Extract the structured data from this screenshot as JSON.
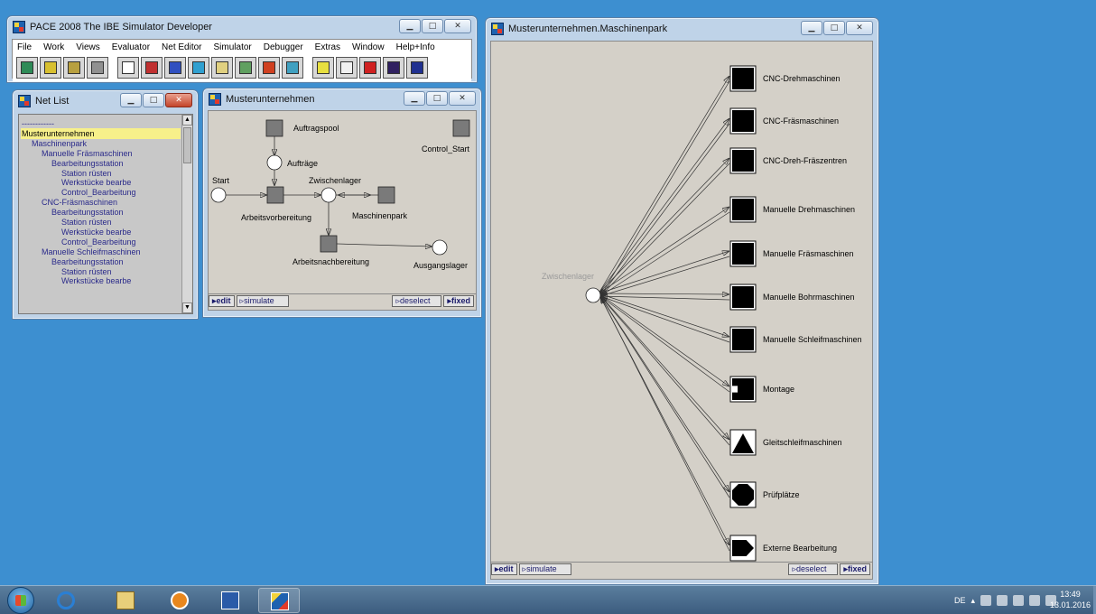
{
  "main_window": {
    "title": "PACE 2008   The IBE Simulator Developer",
    "menu": [
      "File",
      "Work",
      "Views",
      "Evaluator",
      "Net Editor",
      "Simulator",
      "Debugger",
      "Extras",
      "Window",
      "Help+Info"
    ],
    "toolbar_icons": [
      "palette-icon",
      "open-icon",
      "save-icon",
      "copy-icon",
      "grid-icon",
      "bar-chart-icon",
      "column-chart-icon",
      "clock-icon",
      "line-chart-icon",
      "curve-chart-icon",
      "star-icon",
      "calendar-icon",
      "notes-icon",
      "document-icon",
      "hand-stop-icon",
      "debug-icon",
      "book-icon"
    ]
  },
  "netlist_window": {
    "title": "Net List",
    "items": [
      {
        "label": "------------",
        "level": 0,
        "selected": false
      },
      {
        "label": "Musterunternehmen",
        "level": 0,
        "selected": true
      },
      {
        "label": "Maschinenpark",
        "level": 1,
        "selected": false
      },
      {
        "label": "Manuelle Fräsmaschinen",
        "level": 2,
        "selected": false
      },
      {
        "label": "Bearbeitungsstation",
        "level": 3,
        "selected": false
      },
      {
        "label": "Station rüsten",
        "level": 4,
        "selected": false
      },
      {
        "label": "Werkstücke bearbe",
        "level": 4,
        "selected": false
      },
      {
        "label": "Control_Bearbeitung",
        "level": 4,
        "selected": false
      },
      {
        "label": "CNC-Fräsmaschinen",
        "level": 2,
        "selected": false
      },
      {
        "label": "Bearbeitungsstation",
        "level": 3,
        "selected": false
      },
      {
        "label": "Station rüsten",
        "level": 4,
        "selected": false
      },
      {
        "label": "Werkstücke bearbe",
        "level": 4,
        "selected": false
      },
      {
        "label": "Control_Bearbeitung",
        "level": 4,
        "selected": false
      },
      {
        "label": "Manuelle Schleifmaschinen",
        "level": 2,
        "selected": false
      },
      {
        "label": "Bearbeitungsstation",
        "level": 3,
        "selected": false
      },
      {
        "label": "Station rüsten",
        "level": 4,
        "selected": false
      },
      {
        "label": "Werkstücke bearbe",
        "level": 4,
        "selected": false
      }
    ]
  },
  "net_window": {
    "title": "Musterunternehmen",
    "labels": {
      "auftragspool": "Auftragspool",
      "control_start": "Control_Start",
      "auftraege": "Aufträge",
      "start": "Start",
      "zwischenlager": "Zwischenlager",
      "arbeitsvorbereitung": "Arbeitsvorbereitung",
      "maschinenpark": "Maschinenpark",
      "arbeitsnachbereitung": "Arbeitsnachbereitung",
      "ausgangslager": "Ausgangslager"
    }
  },
  "park_window": {
    "title": "Musterunternehmen.Maschinenpark",
    "center_label": "Zwischenlager",
    "machines": [
      {
        "label": "CNC-Drehmaschinen",
        "shape": "square"
      },
      {
        "label": "CNC-Fräsmaschinen",
        "shape": "square"
      },
      {
        "label": "CNC-Dreh-Fräszentren",
        "shape": "square"
      },
      {
        "label": "Manuelle Drehmaschinen",
        "shape": "square"
      },
      {
        "label": "Manuelle Fräsmaschinen",
        "shape": "square"
      },
      {
        "label": "Manuelle Bohrmaschinen",
        "shape": "square"
      },
      {
        "label": "Manuelle Schleifmaschinen",
        "shape": "square"
      },
      {
        "label": "Montage",
        "shape": "notched-square"
      },
      {
        "label": "Gleitschleifmaschinen",
        "shape": "triangle"
      },
      {
        "label": "Prüfplätze",
        "shape": "octagon"
      },
      {
        "label": "Externe Bearbeitung",
        "shape": "pentagon-arrow"
      }
    ]
  },
  "statusbar": {
    "edit": "edit",
    "simulate": "simulate",
    "deselect": "deselect",
    "fixed": "fixed"
  },
  "taskbar": {
    "apps": [
      "ie-icon",
      "explorer-icon",
      "media-player-icon",
      "word-icon",
      "pace-icon"
    ],
    "language": "DE",
    "time": "13:49",
    "date": "13.01.2016"
  }
}
